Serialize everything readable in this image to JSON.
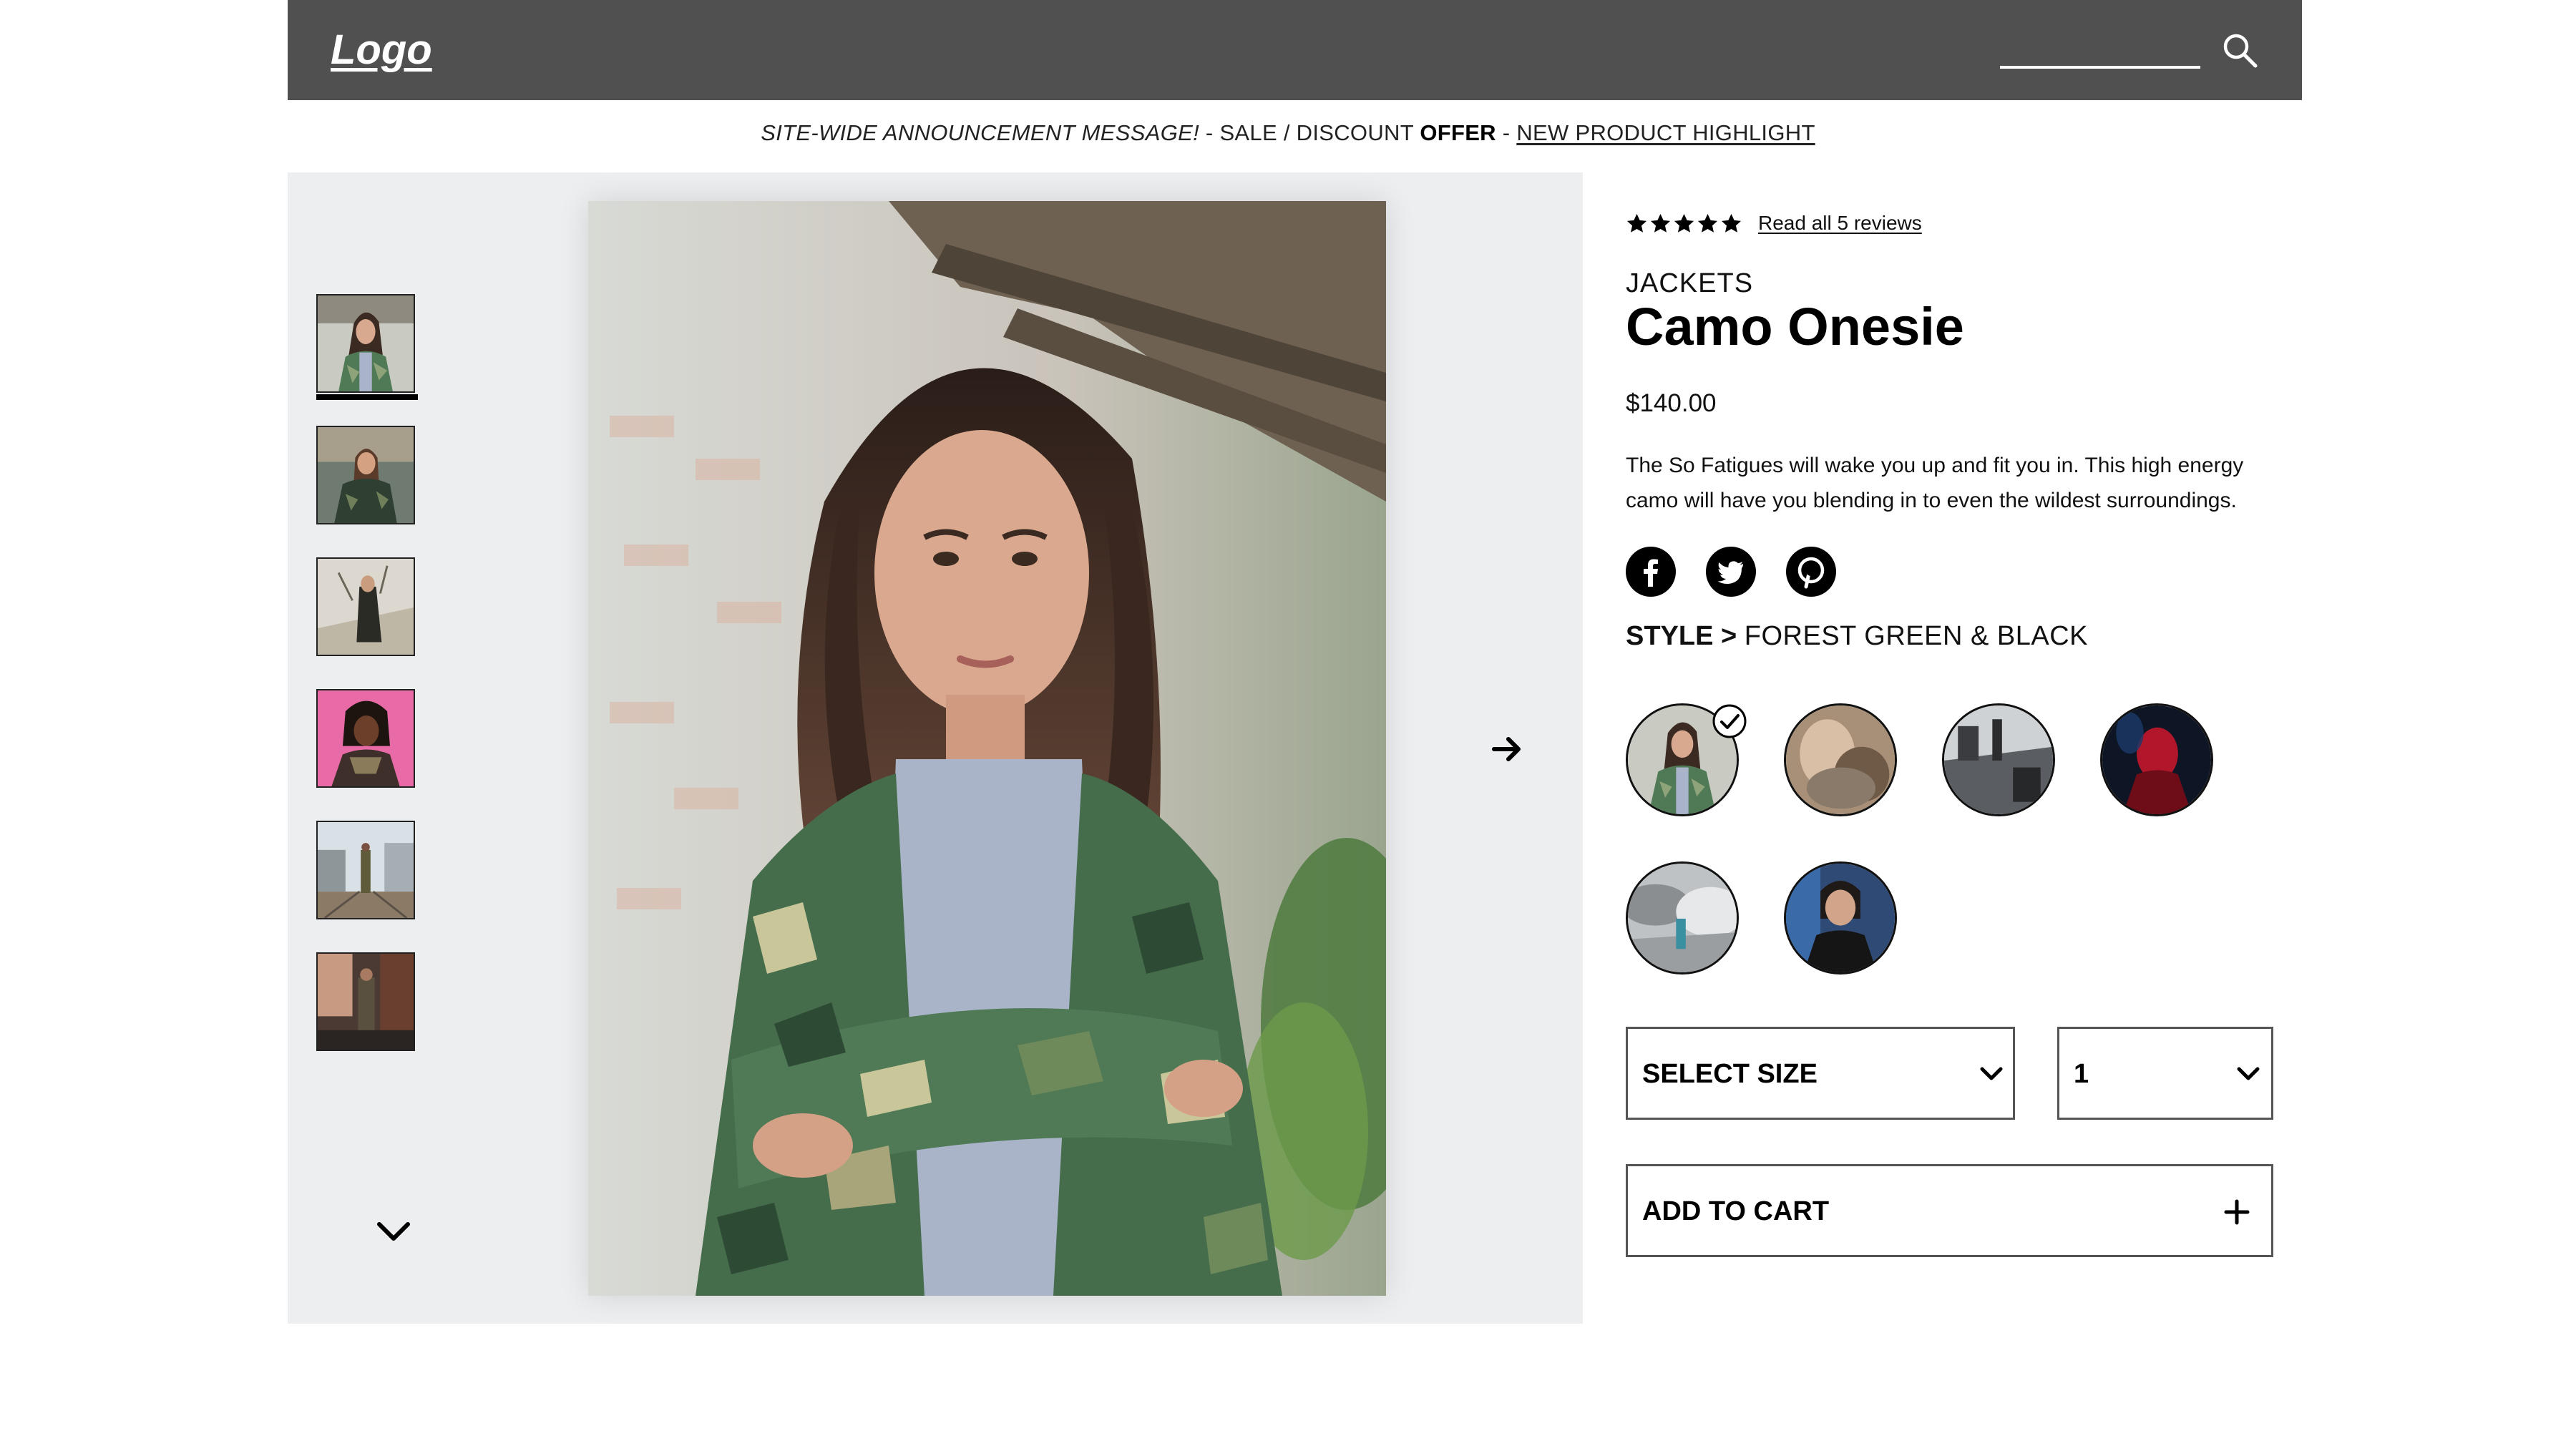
{
  "header": {
    "logo": "Logo",
    "search_placeholder": "",
    "background": "#505050"
  },
  "announcement": {
    "message": "SITE-WIDE ANNOUNCEMENT MESSAGE!",
    "sep1": " - SALE / DISCOUNT ",
    "offer": "OFFER",
    "sep2": " - ",
    "link": "NEW PRODUCT HIGHLIGHT"
  },
  "gallery": {
    "thumbnails": [
      "thumb-1",
      "thumb-2",
      "thumb-3",
      "thumb-4",
      "thumb-5",
      "thumb-6"
    ],
    "active_thumbnail": 1
  },
  "product": {
    "rating": 5,
    "reviews_link": "Read all 5 reviews",
    "category": "JACKETS",
    "title": "Camo Onesie",
    "price": "$140.00",
    "description": "The So Fatigues will wake you up and fit you in. This high energy camo will have you blending in to even the wildest surroundings.",
    "social": [
      "facebook-icon",
      "twitter-icon",
      "pinterest-icon"
    ],
    "style_label": "STYLE >",
    "style_value": "FOREST GREEN & BLACK",
    "swatches_selected": 1,
    "size_label": "SELECT SIZE",
    "quantity_value": "1",
    "cart_label": "ADD TO CART"
  }
}
